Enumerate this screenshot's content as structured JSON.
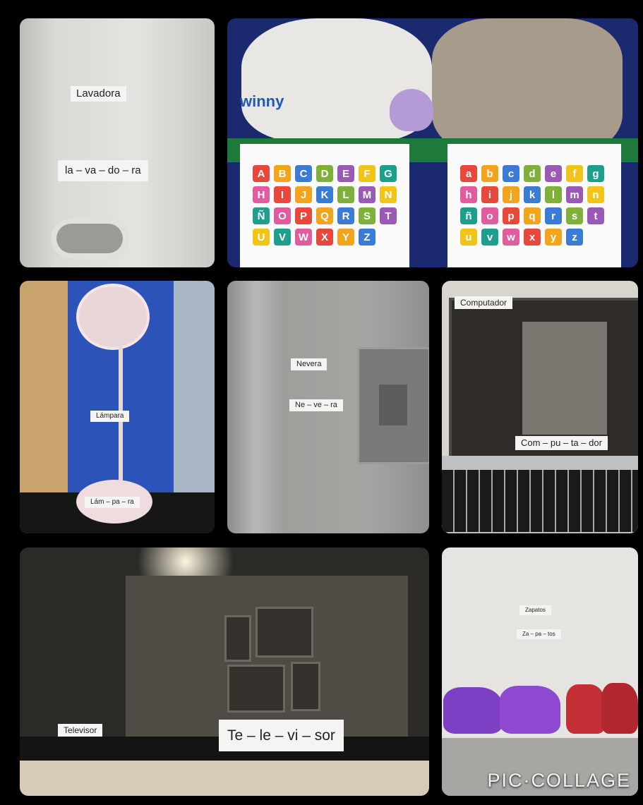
{
  "panels": {
    "lavadora": {
      "word": "Lavadora",
      "syllables": "la – va – do – ra"
    },
    "toys": {
      "brand": "winny",
      "uppercase": [
        "A",
        "B",
        "C",
        "D",
        "E",
        "F",
        "G",
        "H",
        "I",
        "J",
        "K",
        "L",
        "M",
        "N",
        "Ñ",
        "O",
        "P",
        "Q",
        "R",
        "S",
        "T",
        "U",
        "V",
        "W",
        "X",
        "Y",
        "Z"
      ],
      "lowercase": [
        "a",
        "b",
        "c",
        "d",
        "e",
        "f",
        "g",
        "h",
        "i",
        "j",
        "k",
        "l",
        "m",
        "n",
        "ñ",
        "o",
        "p",
        "q",
        "r",
        "s",
        "t",
        "u",
        "v",
        "w",
        "x",
        "y",
        "z"
      ],
      "tile_colors": [
        "#e8473b",
        "#f2a51c",
        "#3a7bd5",
        "#7fb03a",
        "#9b59b6",
        "#f0c419",
        "#1e9e8c",
        "#e05c9e"
      ]
    },
    "lampara": {
      "word": "Lámpara",
      "syllables": "Lám – pa – ra"
    },
    "nevera": {
      "word": "Nevera",
      "syllables": "Ne – ve – ra"
    },
    "computador": {
      "word": "Computador",
      "syllables": "Com – pu – ta – dor"
    },
    "televisor": {
      "word": "Televisor",
      "syllables": "Te – le – vi – sor"
    },
    "zapatos": {
      "word": "Zapatos",
      "syllables": "Za – pa – tos",
      "watermark": "PIC·COLLAGE"
    }
  }
}
